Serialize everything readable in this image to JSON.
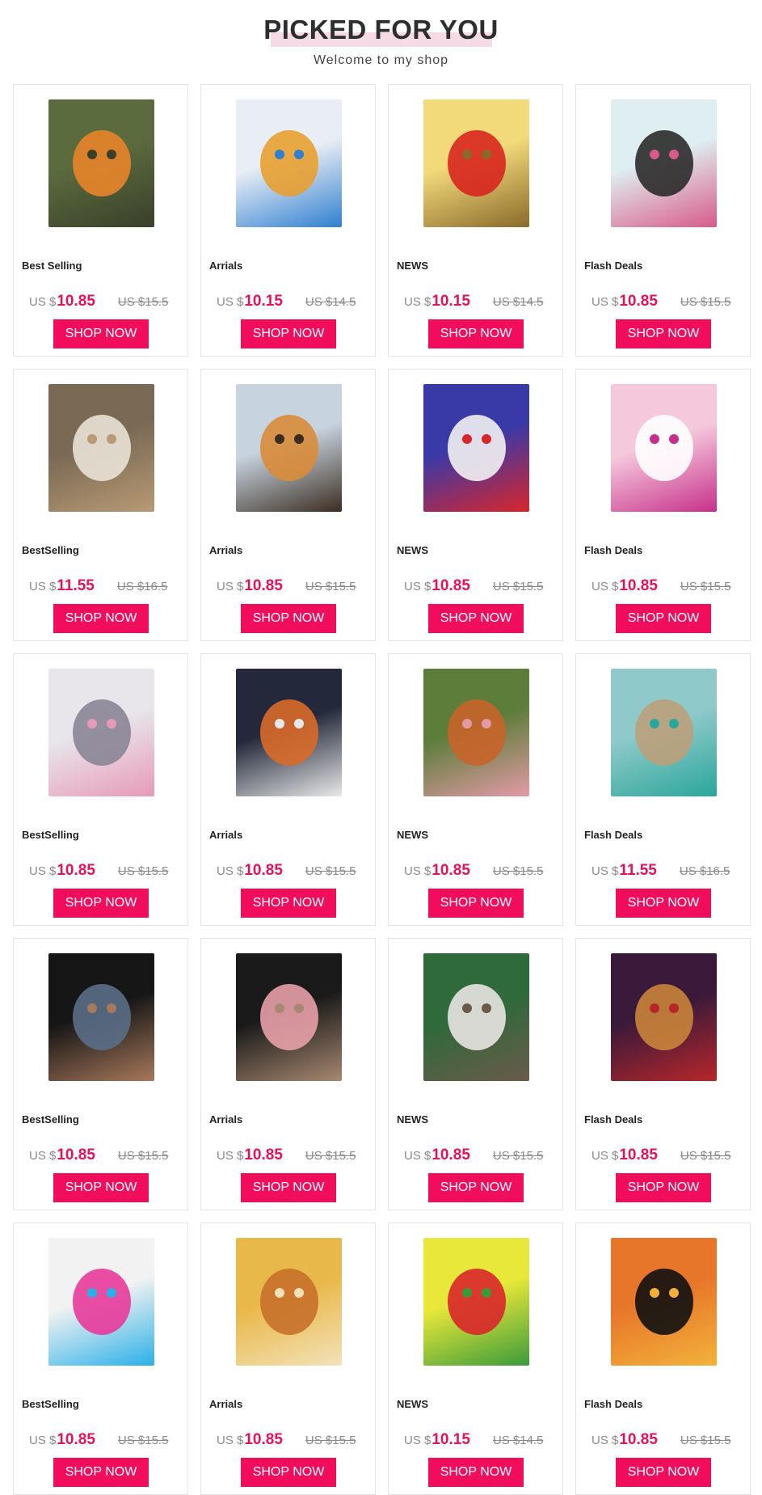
{
  "header": {
    "title": "PICKED FOR YOU",
    "subtitle": "Welcome to my shop"
  },
  "products": [
    {
      "label": "Best Selling",
      "currency": "US $",
      "price": "10.85",
      "old_price": "US $15.5",
      "button": "SHOP NOW",
      "image": "pumpkin-scarecrow-painting",
      "colors": [
        "#5b6b3e",
        "#e8842a",
        "#3a3f2a"
      ]
    },
    {
      "label": "Arrials",
      "currency": "US $",
      "price": "10.15",
      "old_price": "US $14.5",
      "button": "SHOP NOW",
      "image": "colorful-giraffes-painting",
      "colors": [
        "#e9eef5",
        "#e8a030",
        "#2f7fd0"
      ]
    },
    {
      "label": "NEWS",
      "currency": "US $",
      "price": "10.15",
      "old_price": "US $14.5",
      "button": "SHOP NOW",
      "image": "red-parrot-painting",
      "colors": [
        "#f2d97a",
        "#d8261f",
        "#8a6a2a"
      ]
    },
    {
      "label": "Flash Deals",
      "currency": "US $",
      "price": "10.85",
      "old_price": "US $15.5",
      "button": "SHOP NOW",
      "image": "colorful-cow-painting",
      "colors": [
        "#dfeef0",
        "#2b2b2b",
        "#d85a8a"
      ]
    },
    {
      "label": "BestSelling",
      "currency": "US $",
      "price": "11.55",
      "old_price": "US $16.5",
      "button": "SHOP NOW",
      "image": "cat-with-mice-painting",
      "colors": [
        "#7a6a55",
        "#e9e2d6",
        "#b89a74"
      ]
    },
    {
      "label": "Arrials",
      "currency": "US $",
      "price": "10.85",
      "old_price": "US $15.5",
      "button": "SHOP NOW",
      "image": "tiger-cub-painting",
      "colors": [
        "#c7d3df",
        "#d98c3a",
        "#3b2d20"
      ]
    },
    {
      "label": "NEWS",
      "currency": "US $",
      "price": "10.85",
      "old_price": "US $15.5",
      "button": "SHOP NOW",
      "image": "white-tiger-santa-hat-painting",
      "colors": [
        "#3a39a8",
        "#f2f2f2",
        "#d8262a"
      ]
    },
    {
      "label": "Flash Deals",
      "currency": "US $",
      "price": "10.85",
      "old_price": "US $15.5",
      "button": "SHOP NOW",
      "image": "pink-cat-roses-painting",
      "colors": [
        "#f5c8dc",
        "#ffffff",
        "#c7308a"
      ]
    },
    {
      "label": "BestSelling",
      "currency": "US $",
      "price": "10.85",
      "old_price": "US $15.5",
      "button": "SHOP NOW",
      "image": "teddy-bear-flowers-painting",
      "colors": [
        "#e8e6ea",
        "#8a8596",
        "#e79ab8"
      ]
    },
    {
      "label": "Arrials",
      "currency": "US $",
      "price": "10.85",
      "old_price": "US $15.5",
      "button": "SHOP NOW",
      "image": "raccoon-fox-painting",
      "colors": [
        "#23293a",
        "#d86a2a",
        "#e9e9e9"
      ]
    },
    {
      "label": "NEWS",
      "currency": "US $",
      "price": "10.85",
      "old_price": "US $15.5",
      "button": "SHOP NOW",
      "image": "fox-cubs-flowers-painting",
      "colors": [
        "#5d7d3a",
        "#c8642a",
        "#e39aa6"
      ]
    },
    {
      "label": "Flash Deals",
      "currency": "US $",
      "price": "11.55",
      "old_price": "US $16.5",
      "button": "SHOP NOW",
      "image": "owl-painting",
      "colors": [
        "#8fc9c9",
        "#bba07a",
        "#2aa79a"
      ]
    },
    {
      "label": "BestSelling",
      "currency": "US $",
      "price": "10.85",
      "old_price": "US $15.5",
      "button": "SHOP NOW",
      "image": "cat-knit-hat-painting",
      "colors": [
        "#161616",
        "#5a6e86",
        "#a8785a"
      ]
    },
    {
      "label": "Arrials",
      "currency": "US $",
      "price": "10.85",
      "old_price": "US $15.5",
      "button": "SHOP NOW",
      "image": "bunny-hat-painting",
      "colors": [
        "#1a1a1a",
        "#e8a0a8",
        "#a88870"
      ]
    },
    {
      "label": "NEWS",
      "currency": "US $",
      "price": "10.85",
      "old_price": "US $15.5",
      "button": "SHOP NOW",
      "image": "white-tiger-cub-painting",
      "colors": [
        "#2e6a3a",
        "#e9e6e2",
        "#6a5a4a"
      ]
    },
    {
      "label": "Flash Deals",
      "currency": "US $",
      "price": "10.85",
      "old_price": "US $15.5",
      "button": "SHOP NOW",
      "image": "halloween-bear-painting",
      "colors": [
        "#3a1a3a",
        "#c9843a",
        "#b8262a"
      ]
    },
    {
      "label": "BestSelling",
      "currency": "US $",
      "price": "10.85",
      "old_price": "US $15.5",
      "button": "SHOP NOW",
      "image": "rainbow-unicorn-painting",
      "colors": [
        "#f2f2f2",
        "#e83a9a",
        "#2ab0e8"
      ]
    },
    {
      "label": "Arrials",
      "currency": "US $",
      "price": "10.85",
      "old_price": "US $15.5",
      "button": "SHOP NOW",
      "image": "sleeping-fox-painting",
      "colors": [
        "#e9b84a",
        "#c8702a",
        "#f2e2b8"
      ]
    },
    {
      "label": "NEWS",
      "currency": "US $",
      "price": "10.15",
      "old_price": "US $14.5",
      "button": "SHOP NOW",
      "image": "parrots-jungle-painting",
      "colors": [
        "#e8e83a",
        "#d8262a",
        "#3a9a3a"
      ]
    },
    {
      "label": "Flash Deals",
      "currency": "US $",
      "price": "10.85",
      "old_price": "US $15.5",
      "button": "SHOP NOW",
      "image": "black-cat-pumpkin-painting",
      "colors": [
        "#e8762a",
        "#111111",
        "#f2b23a"
      ]
    }
  ]
}
